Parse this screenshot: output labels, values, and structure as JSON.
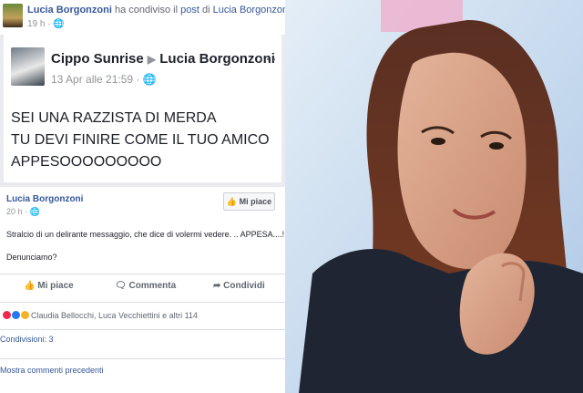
{
  "share": {
    "line_name1": "Lucia Borgonzoni",
    "line_mid": " ha condiviso il ",
    "line_link": "post",
    "line_of": " di ",
    "line_name2": "Lucia Borgonzoni.",
    "meta": "19 h · 🌐"
  },
  "shared_post": {
    "author": "Cippo Sunrise",
    "arrow": "▶",
    "target": "Lucia Borgonzoni",
    "date": "13 Apr alle 21:59 · 🌐",
    "more": "···",
    "lines": [
      "SEI UNA RAZZISTA DI MERDA",
      "TU DEVI FINIRE COME IL TUO AMICO",
      "APPESOOOOOOOOO"
    ]
  },
  "post": {
    "author": "Lucia Borgonzoni",
    "meta": "20 h · 🌐",
    "like_page": "👍 Mi piace",
    "body": "Stralcio di un delirante messaggio, che dice di volermi vedere. .. APPESA....!",
    "body2": "Denunciamo?"
  },
  "actions": {
    "like": "Mi piace",
    "comment": "Commenta",
    "share": "Condividi"
  },
  "reactions": {
    "text": "Claudia Bellocchi, Luca Vecchiettini e altri 114",
    "colors": [
      "#f0284a",
      "#2078f4",
      "#f7b125"
    ]
  },
  "shares": "Condivisioni: 3",
  "more_comments": "Mostra commenti precedenti"
}
